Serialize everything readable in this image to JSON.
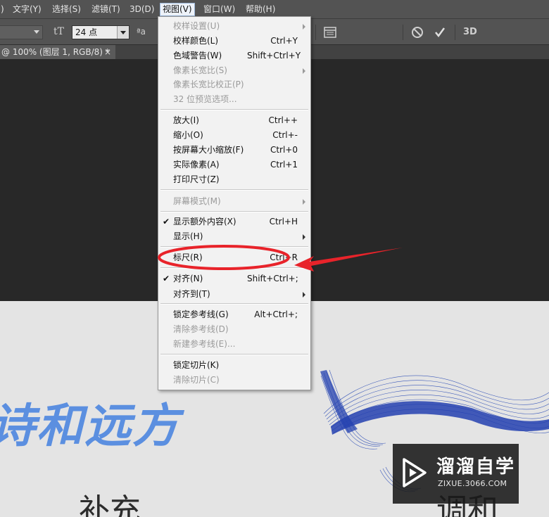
{
  "menubar": {
    "items": [
      {
        "label": ")"
      },
      {
        "label": "文字(Y)"
      },
      {
        "label": "选择(S)"
      },
      {
        "label": "滤镜(T)"
      },
      {
        "label": "3D(D)"
      },
      {
        "label": "视图(V)"
      },
      {
        "label": "窗口(W)"
      },
      {
        "label": "帮助(H)"
      }
    ]
  },
  "options": {
    "font_size_value": "24 点",
    "aa_label": "ªa",
    "tT_label": "tT",
    "threeD_label": "3D"
  },
  "tab": {
    "title": "@ 100% (图层 1, RGB/8) *",
    "close": "×"
  },
  "view_menu": {
    "items": [
      {
        "label": "校样设置(U)",
        "shortcut": "",
        "disabled": true,
        "submenu": true,
        "checked": false
      },
      {
        "label": "校样颜色(L)",
        "shortcut": "Ctrl+Y",
        "disabled": false,
        "submenu": false,
        "checked": false
      },
      {
        "label": "色域警告(W)",
        "shortcut": "Shift+Ctrl+Y",
        "disabled": false,
        "submenu": false,
        "checked": false
      },
      {
        "label": "像素长宽比(S)",
        "shortcut": "",
        "disabled": true,
        "submenu": true,
        "checked": false
      },
      {
        "label": "像素长宽比校正(P)",
        "shortcut": "",
        "disabled": true,
        "submenu": false,
        "checked": false
      },
      {
        "label": "32 位预览选项...",
        "shortcut": "",
        "disabled": true,
        "submenu": false,
        "checked": false
      },
      {
        "label": "放大(I)",
        "shortcut": "Ctrl++",
        "disabled": false,
        "submenu": false,
        "checked": false
      },
      {
        "label": "缩小(O)",
        "shortcut": "Ctrl+-",
        "disabled": false,
        "submenu": false,
        "checked": false
      },
      {
        "label": "按屏幕大小缩放(F)",
        "shortcut": "Ctrl+0",
        "disabled": false,
        "submenu": false,
        "checked": false
      },
      {
        "label": "实际像素(A)",
        "shortcut": "Ctrl+1",
        "disabled": false,
        "submenu": false,
        "checked": false
      },
      {
        "label": "打印尺寸(Z)",
        "shortcut": "",
        "disabled": false,
        "submenu": false,
        "checked": false
      },
      {
        "label": "屏幕模式(M)",
        "shortcut": "",
        "disabled": true,
        "submenu": true,
        "checked": false
      },
      {
        "label": "显示额外内容(X)",
        "shortcut": "Ctrl+H",
        "disabled": false,
        "submenu": false,
        "checked": true
      },
      {
        "label": "显示(H)",
        "shortcut": "",
        "disabled": false,
        "submenu": true,
        "checked": false
      },
      {
        "label": "标尺(R)",
        "shortcut": "Ctrl+R",
        "disabled": false,
        "submenu": false,
        "checked": false
      },
      {
        "label": "对齐(N)",
        "shortcut": "Shift+Ctrl+;",
        "disabled": false,
        "submenu": false,
        "checked": true
      },
      {
        "label": "对齐到(T)",
        "shortcut": "",
        "disabled": false,
        "submenu": true,
        "checked": false
      },
      {
        "label": "锁定参考线(G)",
        "shortcut": "Alt+Ctrl+;",
        "disabled": false,
        "submenu": false,
        "checked": false
      },
      {
        "label": "清除参考线(D)",
        "shortcut": "",
        "disabled": true,
        "submenu": false,
        "checked": false
      },
      {
        "label": "新建参考线(E)...",
        "shortcut": "",
        "disabled": true,
        "submenu": false,
        "checked": false
      },
      {
        "label": "锁定切片(K)",
        "shortcut": "",
        "disabled": false,
        "submenu": false,
        "checked": false
      },
      {
        "label": "清除切片(C)",
        "shortcut": "",
        "disabled": true,
        "submenu": false,
        "checked": false
      }
    ]
  },
  "canvas": {
    "poem_text": "诗和远方",
    "bottom_left_text": "补充",
    "bottom_right_text": "调和",
    "accent_color": "#5b8fe0",
    "whale_color": "#2244aa"
  },
  "watermark": {
    "title": "溜溜自学",
    "url": "ZIXUE.3066.COM"
  },
  "annotation": {
    "color": "#e8232a"
  }
}
